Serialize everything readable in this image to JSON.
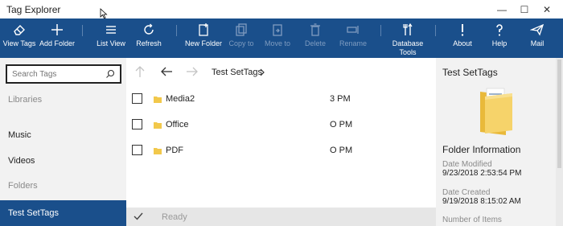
{
  "window": {
    "title": "Tag Explorer",
    "minimize_glyph": "—",
    "maximize_glyph": "☐",
    "close_glyph": "✕"
  },
  "toolbar": {
    "items": [
      {
        "label": "View Tags",
        "icon": "tag-eraser-icon",
        "enabled": true
      },
      {
        "label": "Add Folder",
        "icon": "plus-icon",
        "enabled": true
      },
      {
        "label": "List View",
        "icon": "list-icon",
        "enabled": true
      },
      {
        "label": "Refresh",
        "icon": "refresh-icon",
        "enabled": true
      },
      {
        "label": "New Folder",
        "icon": "new-folder-icon",
        "enabled": true
      },
      {
        "label": "Copy to",
        "icon": "copy-icon",
        "enabled": false
      },
      {
        "label": "Move to",
        "icon": "move-icon",
        "enabled": false
      },
      {
        "label": "Delete",
        "icon": "trash-icon",
        "enabled": false
      },
      {
        "label": "Rename",
        "icon": "rename-icon",
        "enabled": false
      },
      {
        "label": "Database Tools",
        "label_line1": "Database",
        "label_line2": "Tools",
        "icon": "tools-icon",
        "enabled": true
      },
      {
        "label": "About",
        "icon": "exclamation-icon",
        "enabled": true
      },
      {
        "label": "Help",
        "icon": "question-icon",
        "enabled": true
      },
      {
        "label": "Mail",
        "icon": "send-icon",
        "enabled": true
      }
    ]
  },
  "sidebar": {
    "search_placeholder": "Search Tags",
    "libraries_header": "Libraries",
    "libraries": [
      "Music",
      "Videos"
    ],
    "folders_header": "Folders",
    "selected_folder": "Test SetTags"
  },
  "main": {
    "breadcrumb": "Test SetTags",
    "files": [
      {
        "name": "Media2",
        "time_fragment": "3 PM"
      },
      {
        "name": "Office",
        "time_fragment": "O PM"
      },
      {
        "name": "PDF",
        "time_fragment": "O PM"
      }
    ],
    "status": "Ready"
  },
  "details": {
    "title": "Test SetTags",
    "section": "Folder Information",
    "date_modified_label": "Date Modified",
    "date_modified": "9/23/2018 2:53:54 PM",
    "date_created_label": "Date Created",
    "date_created": "9/19/2018 8:15:02 AM",
    "number_of_items_label": "Number of Items"
  },
  "colors": {
    "ribbon": "#1a4f8b",
    "selection": "#1a4f8b",
    "folder": "#f2c84b"
  }
}
